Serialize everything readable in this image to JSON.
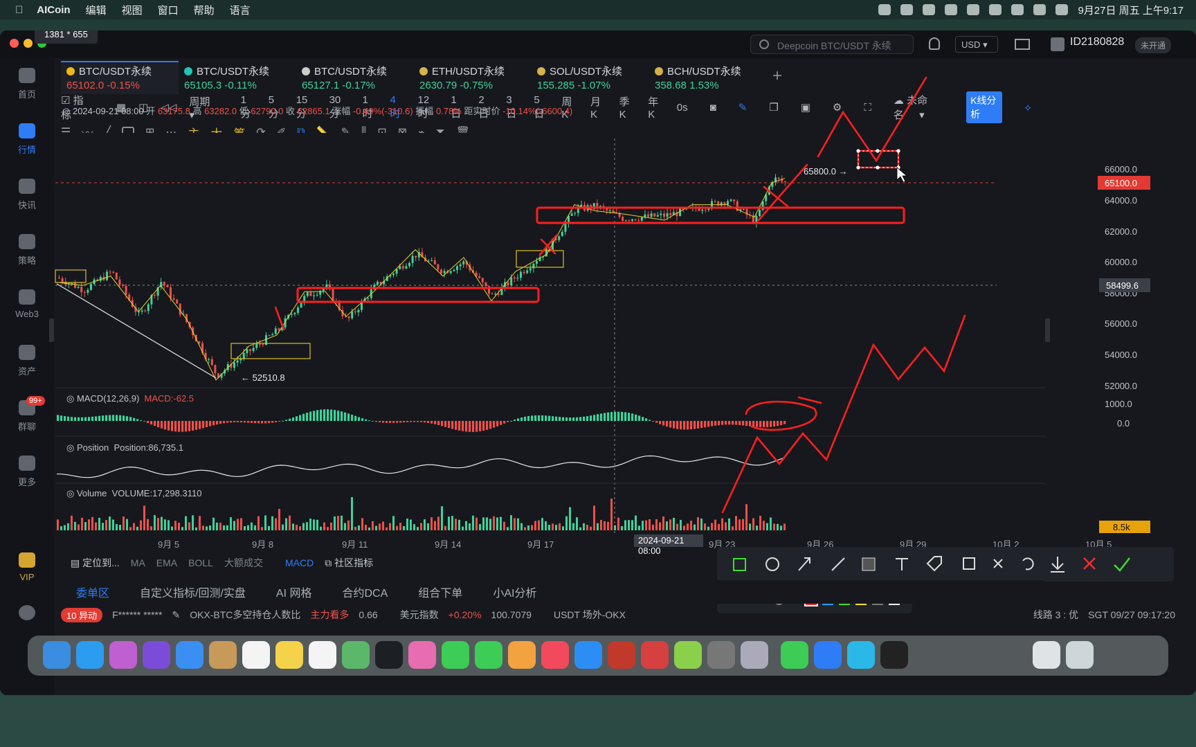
{
  "menubar": {
    "app": "AICoin",
    "items": [
      "编辑",
      "视图",
      "窗口",
      "帮助",
      "语言"
    ],
    "clock": "9月27日 周五 上午9:17"
  },
  "window": {
    "size_badge": "1381 * 655",
    "search_placeholder": "Deepcoin BTC/USDT 永续",
    "currency": "USD",
    "account": "ID2180828",
    "account_status": "未开通"
  },
  "sidebar": [
    {
      "label": "首页"
    },
    {
      "label": "行情"
    },
    {
      "label": "快讯"
    },
    {
      "label": "策略"
    },
    {
      "label": "Web3"
    },
    {
      "label": "资产"
    },
    {
      "label": "群聊",
      "badge": "99+"
    },
    {
      "label": "更多"
    },
    {
      "label": "VIP"
    }
  ],
  "tabs": [
    {
      "name": "BTC/USDT永续",
      "price": "65102.0",
      "change": "-0.15%",
      "dir": "down",
      "color": "#f2b713"
    },
    {
      "name": "BTC/USDT永续",
      "price": "65105.3",
      "change": "-0.11%",
      "dir": "up",
      "color": "#23c4b4"
    },
    {
      "name": "BTC/USDT永续",
      "price": "65127.1",
      "change": "-0.17%",
      "dir": "up",
      "color": "#cccccc"
    },
    {
      "name": "ETH/USDT永续",
      "price": "2630.79",
      "change": "-0.75%",
      "dir": "up",
      "color": "#d6b24a"
    },
    {
      "name": "SOL/USDT永续",
      "price": "155.285",
      "change": "-1.07%",
      "dir": "up",
      "color": "#d6b24a"
    },
    {
      "name": "BCH/USDT永续",
      "price": "358.68",
      "change": "1.53%",
      "dir": "up",
      "color": "#d6b24a"
    }
  ],
  "toolbar": {
    "indicator": "指标",
    "period": "周期",
    "intervals": [
      "1分",
      "5分",
      "15分",
      "30分",
      "1时",
      "4时",
      "12时",
      "1日",
      "2日",
      "3日",
      "5日",
      "周K",
      "月K",
      "季K",
      "年K"
    ],
    "active_interval": "4时",
    "countdown": "0s",
    "layout_name": "未命名",
    "k_analysis": "K线分析",
    "chars": [
      "主",
      "大",
      "筹"
    ]
  },
  "ohlc": {
    "date": "2024-09-21 08:00",
    "open_label": "开",
    "open": "63175.8",
    "high_label": "高",
    "high": "63282.0",
    "low_label": "低",
    "low": "62790.0",
    "close_label": "收",
    "close": "62865.1",
    "change_label": "涨幅",
    "change": "-0.49%(-310.6)",
    "amp_label": "振幅",
    "amp": "0.78%",
    "dist_label": "距实时价",
    "dist": "-10.14%(-6600.4)"
  },
  "panels": {
    "macd_label": "MACD(12,26,9)",
    "macd_value": "MACD:-62.5",
    "position_label": "Position",
    "position_value": "Position:86,735.1",
    "volume_label": "Volume",
    "volume_value": "VOLUME:17,298.3110"
  },
  "price_axis": [
    "66000.0",
    "64000.0",
    "62000.0",
    "60000.0",
    "58000.0",
    "56000.0",
    "54000.0",
    "52000.0"
  ],
  "macd_axis": [
    "1000.0",
    "0.0"
  ],
  "tags": {
    "last_price": "65100.0",
    "crosshair_price": "58499.6",
    "volume": "8.5k",
    "crosshair_date": "2024-09-21 08:00",
    "high_mark": "65800.0 →",
    "low_mark": "← 52510.8"
  },
  "time_axis": [
    "9月 5",
    "9月 8",
    "9月 11",
    "9月 14",
    "9月 17",
    "9月 23",
    "9月 26",
    "9月 29",
    "10月 2",
    "10月 5"
  ],
  "indicator_row": {
    "locate": "定位到...",
    "items": [
      "MA",
      "EMA",
      "BOLL",
      "大额成交",
      "MACD"
    ],
    "active": "MACD",
    "community": "社区指标"
  },
  "bottom_tabs": [
    "委单区",
    "自定义指标/回测/实盘",
    "AI 网格",
    "合约DCA",
    "组合下单",
    "小AI分析"
  ],
  "ticker": {
    "badge": "10 异动",
    "user": "F****** *****",
    "item1": "OKX-BTC多空持仓人数比",
    "item1_tag": "主力看多",
    "item1_val": "0.66",
    "item2": "美元指数",
    "item2_chg": "+0.20%",
    "item2_val": "100.7079",
    "item3": "USDT 场外-OKX",
    "line": "线路 3 : 优",
    "time": "SGT 09/27 09:17:20"
  },
  "colors": {
    "up": "#3fd29a",
    "down": "#f0504a",
    "accent": "#2f7df6",
    "annotation": "#ff1f1f",
    "highlight": "#e0c020"
  },
  "draw_palette": [
    "#ff2a2a",
    "#1ea0ff",
    "#3be02a",
    "#ffe21a",
    "#7a7a7a",
    "#ffffff"
  ]
}
